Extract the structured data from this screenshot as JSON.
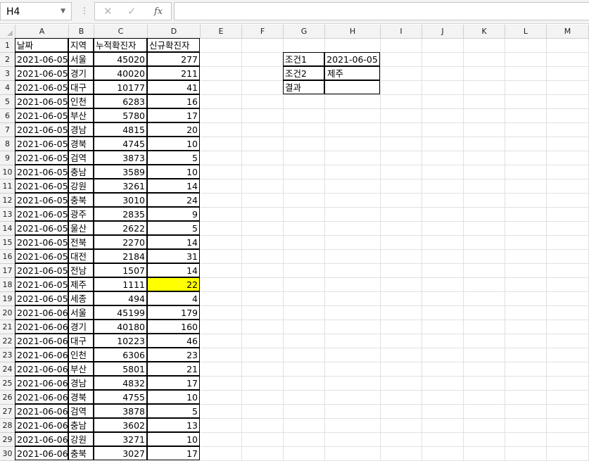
{
  "formula_bar": {
    "name_box": "H4",
    "dots": "⋮",
    "cancel_glyph": "✕",
    "enter_glyph": "✓",
    "fx_label": "fx",
    "formula": ""
  },
  "columns": [
    "A",
    "B",
    "C",
    "D",
    "E",
    "F",
    "G",
    "H",
    "I",
    "J",
    "K",
    "L",
    "M"
  ],
  "header_row": [
    "날짜",
    "지역",
    "누적확진자",
    "신규확진자"
  ],
  "data_rows": [
    [
      "2021-06-05",
      "서울",
      "45020",
      "277"
    ],
    [
      "2021-06-05",
      "경기",
      "40020",
      "211"
    ],
    [
      "2021-06-05",
      "대구",
      "10177",
      "41"
    ],
    [
      "2021-06-05",
      "인천",
      "6283",
      "16"
    ],
    [
      "2021-06-05",
      "부산",
      "5780",
      "17"
    ],
    [
      "2021-06-05",
      "경남",
      "4815",
      "20"
    ],
    [
      "2021-06-05",
      "경북",
      "4745",
      "10"
    ],
    [
      "2021-06-05",
      "검역",
      "3873",
      "5"
    ],
    [
      "2021-06-05",
      "충남",
      "3589",
      "10"
    ],
    [
      "2021-06-05",
      "강원",
      "3261",
      "14"
    ],
    [
      "2021-06-05",
      "충북",
      "3010",
      "24"
    ],
    [
      "2021-06-05",
      "광주",
      "2835",
      "9"
    ],
    [
      "2021-06-05",
      "울산",
      "2622",
      "5"
    ],
    [
      "2021-06-05",
      "전북",
      "2270",
      "14"
    ],
    [
      "2021-06-05",
      "대전",
      "2184",
      "31"
    ],
    [
      "2021-06-05",
      "전남",
      "1507",
      "14"
    ],
    [
      "2021-06-05",
      "제주",
      "1111",
      "22"
    ],
    [
      "2021-06-05",
      "세종",
      "494",
      "4"
    ],
    [
      "2021-06-06",
      "서울",
      "45199",
      "179"
    ],
    [
      "2021-06-06",
      "경기",
      "40180",
      "160"
    ],
    [
      "2021-06-06",
      "대구",
      "10223",
      "46"
    ],
    [
      "2021-06-06",
      "인천",
      "6306",
      "23"
    ],
    [
      "2021-06-06",
      "부산",
      "5801",
      "21"
    ],
    [
      "2021-06-06",
      "경남",
      "4832",
      "17"
    ],
    [
      "2021-06-06",
      "경북",
      "4755",
      "10"
    ],
    [
      "2021-06-06",
      "검역",
      "3878",
      "5"
    ],
    [
      "2021-06-06",
      "충남",
      "3602",
      "13"
    ],
    [
      "2021-06-06",
      "강원",
      "3271",
      "10"
    ],
    [
      "2021-06-06",
      "충북",
      "3027",
      "17"
    ]
  ],
  "conditions": [
    {
      "label": "조건1",
      "value": "2021-06-05"
    },
    {
      "label": "조건2",
      "value": "제주"
    },
    {
      "label": "결과",
      "value": ""
    }
  ],
  "colors": {
    "highlight": "#ffff00"
  }
}
